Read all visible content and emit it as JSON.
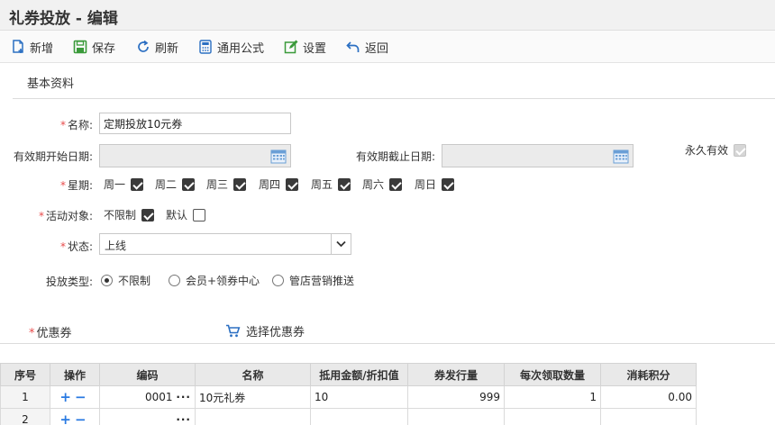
{
  "title": "礼券投放 - 编辑",
  "toolbar": {
    "new": "新增",
    "save": "保存",
    "refresh": "刷新",
    "formula": "通用公式",
    "settings": "设置",
    "back": "返回"
  },
  "basic_section": "基本资料",
  "form": {
    "name_label": "名称:",
    "name_value": "定期投放10元券",
    "start_label": "有效期开始日期:",
    "end_label": "有效期截止日期:",
    "permanent_label": "永久有效",
    "week_label": "星期:",
    "weekdays": [
      "周一",
      "周二",
      "周三",
      "周四",
      "周五",
      "周六",
      "周日"
    ],
    "target_label": "活动对象:",
    "target_unlimited": "不限制",
    "target_default": "默认",
    "status_label": "状态:",
    "status_value": "上线",
    "type_label": "投放类型:",
    "type_options": [
      "不限制",
      "会员+领券中心",
      "管店营销推送"
    ]
  },
  "coupon_section": {
    "label": "优惠券",
    "choose": "选择优惠券"
  },
  "table": {
    "headers": [
      "序号",
      "操作",
      "编码",
      "名称",
      "抵用金额/折扣值",
      "券发行量",
      "每次领取数量",
      "消耗积分"
    ],
    "rows": [
      {
        "seq": "1",
        "code": "0001",
        "name": "10元礼券",
        "amount": "10",
        "issue": "999",
        "per": "1",
        "points": "0.00"
      },
      {
        "seq": "2",
        "code": "",
        "name": "",
        "amount": "",
        "issue": "",
        "per": "",
        "points": ""
      }
    ]
  },
  "colors": {
    "required": "#e84b4b",
    "ops_blue": "#2a7ae2",
    "icon_blue": "#2b6fc2",
    "icon_green": "#3a9a3a"
  }
}
